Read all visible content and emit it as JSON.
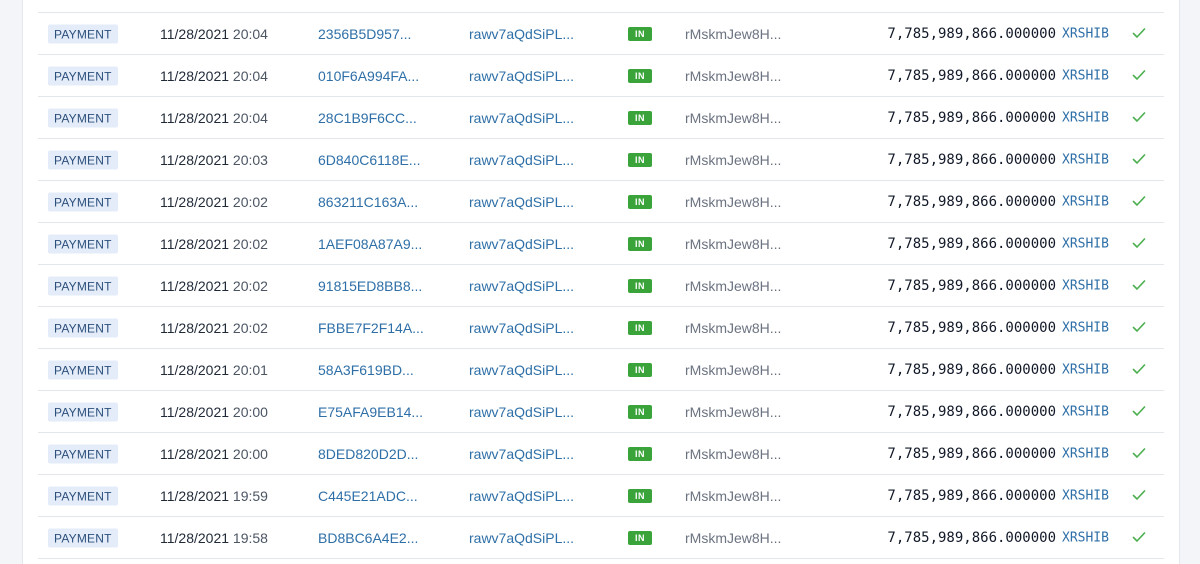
{
  "colors": {
    "accent_link": "#2e6fa7",
    "badge_payment_bg": "#e3ecf8",
    "badge_in_bg": "#3aa33a",
    "success_check": "#4caf50"
  },
  "icons": {
    "status": "checkmark-icon"
  },
  "transactions": [
    {
      "type": "PAYMENT",
      "date": "11/28/2021",
      "time": "20:04",
      "hash": "2356B5D957...",
      "from": "rawv7aQdSiPL...",
      "direction": "IN",
      "to": "rMskmJew8H...",
      "amount": "7,785,989,866.000000",
      "currency": "XRSHIB"
    },
    {
      "type": "PAYMENT",
      "date": "11/28/2021",
      "time": "20:04",
      "hash": "010F6A994FA...",
      "from": "rawv7aQdSiPL...",
      "direction": "IN",
      "to": "rMskmJew8H...",
      "amount": "7,785,989,866.000000",
      "currency": "XRSHIB"
    },
    {
      "type": "PAYMENT",
      "date": "11/28/2021",
      "time": "20:04",
      "hash": "28C1B9F6CC...",
      "from": "rawv7aQdSiPL...",
      "direction": "IN",
      "to": "rMskmJew8H...",
      "amount": "7,785,989,866.000000",
      "currency": "XRSHIB"
    },
    {
      "type": "PAYMENT",
      "date": "11/28/2021",
      "time": "20:03",
      "hash": "6D840C6118E...",
      "from": "rawv7aQdSiPL...",
      "direction": "IN",
      "to": "rMskmJew8H...",
      "amount": "7,785,989,866.000000",
      "currency": "XRSHIB"
    },
    {
      "type": "PAYMENT",
      "date": "11/28/2021",
      "time": "20:02",
      "hash": "863211C163A...",
      "from": "rawv7aQdSiPL...",
      "direction": "IN",
      "to": "rMskmJew8H...",
      "amount": "7,785,989,866.000000",
      "currency": "XRSHIB"
    },
    {
      "type": "PAYMENT",
      "date": "11/28/2021",
      "time": "20:02",
      "hash": "1AEF08A87A9...",
      "from": "rawv7aQdSiPL...",
      "direction": "IN",
      "to": "rMskmJew8H...",
      "amount": "7,785,989,866.000000",
      "currency": "XRSHIB"
    },
    {
      "type": "PAYMENT",
      "date": "11/28/2021",
      "time": "20:02",
      "hash": "91815ED8BB8...",
      "from": "rawv7aQdSiPL...",
      "direction": "IN",
      "to": "rMskmJew8H...",
      "amount": "7,785,989,866.000000",
      "currency": "XRSHIB"
    },
    {
      "type": "PAYMENT",
      "date": "11/28/2021",
      "time": "20:02",
      "hash": "FBBE7F2F14A...",
      "from": "rawv7aQdSiPL...",
      "direction": "IN",
      "to": "rMskmJew8H...",
      "amount": "7,785,989,866.000000",
      "currency": "XRSHIB"
    },
    {
      "type": "PAYMENT",
      "date": "11/28/2021",
      "time": "20:01",
      "hash": "58A3F619BD...",
      "from": "rawv7aQdSiPL...",
      "direction": "IN",
      "to": "rMskmJew8H...",
      "amount": "7,785,989,866.000000",
      "currency": "XRSHIB"
    },
    {
      "type": "PAYMENT",
      "date": "11/28/2021",
      "time": "20:00",
      "hash": "E75AFA9EB14...",
      "from": "rawv7aQdSiPL...",
      "direction": "IN",
      "to": "rMskmJew8H...",
      "amount": "7,785,989,866.000000",
      "currency": "XRSHIB"
    },
    {
      "type": "PAYMENT",
      "date": "11/28/2021",
      "time": "20:00",
      "hash": "8DED820D2D...",
      "from": "rawv7aQdSiPL...",
      "direction": "IN",
      "to": "rMskmJew8H...",
      "amount": "7,785,989,866.000000",
      "currency": "XRSHIB"
    },
    {
      "type": "PAYMENT",
      "date": "11/28/2021",
      "time": "19:59",
      "hash": "C445E21ADC...",
      "from": "rawv7aQdSiPL...",
      "direction": "IN",
      "to": "rMskmJew8H...",
      "amount": "7,785,989,866.000000",
      "currency": "XRSHIB"
    },
    {
      "type": "PAYMENT",
      "date": "11/28/2021",
      "time": "19:58",
      "hash": "BD8BC6A4E2...",
      "from": "rawv7aQdSiPL...",
      "direction": "IN",
      "to": "rMskmJew8H...",
      "amount": "7,785,989,866.000000",
      "currency": "XRSHIB"
    }
  ]
}
